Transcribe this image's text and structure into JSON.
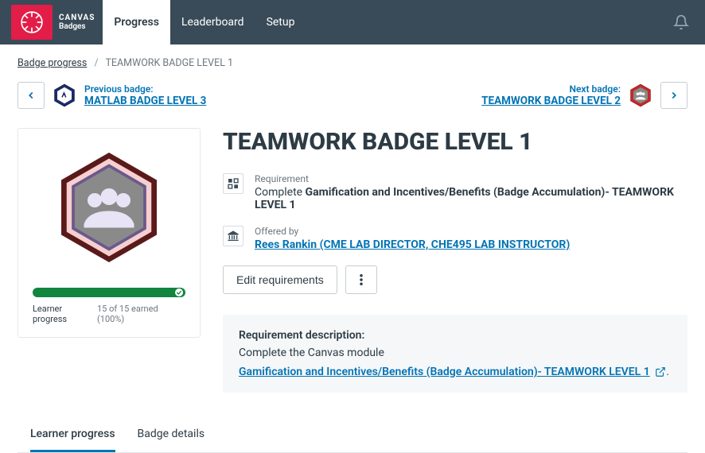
{
  "brand": {
    "top": "CANVAS",
    "bottom": "Badges"
  },
  "topnav": {
    "tabs": [
      "Progress",
      "Leaderboard",
      "Setup"
    ],
    "activeIndex": 0
  },
  "breadcrumb": {
    "root": "Badge progress",
    "current": "TEAMWORK BADGE LEVEL 1"
  },
  "prev": {
    "label": "Previous badge:",
    "name": "MATLAB BADGE LEVEL 3"
  },
  "next": {
    "label": "Next badge:",
    "name": "TEAMWORK BADGE LEVEL 2"
  },
  "title": "TEAMWORK BADGE LEVEL 1",
  "requirement": {
    "label": "Requirement",
    "prefix": "Complete ",
    "name": "Gamification and Incentives/Benefits (Badge Accumulation)- TEAMWORK LEVEL 1"
  },
  "offered": {
    "label": "Offered by",
    "name": "Rees Rankin (CME LAB DIRECTOR, CHE495 LAB INSTRUCTOR)"
  },
  "buttons": {
    "edit": "Edit requirements"
  },
  "reqDesc": {
    "heading": "Requirement description:",
    "desc": "Complete the Canvas module",
    "link": "Gamification and Incentives/Benefits (Badge Accumulation)- TEAMWORK LEVEL 1",
    "dot": "."
  },
  "card": {
    "footerLabel": "Learner progress",
    "footerValue": "15 of 15 earned (100%)"
  },
  "subtabs": {
    "items": [
      "Learner progress",
      "Badge details"
    ],
    "activeIndex": 0
  },
  "colors": {
    "accent": "#0374b5",
    "success": "#12853f",
    "brand": "#e11d48"
  }
}
